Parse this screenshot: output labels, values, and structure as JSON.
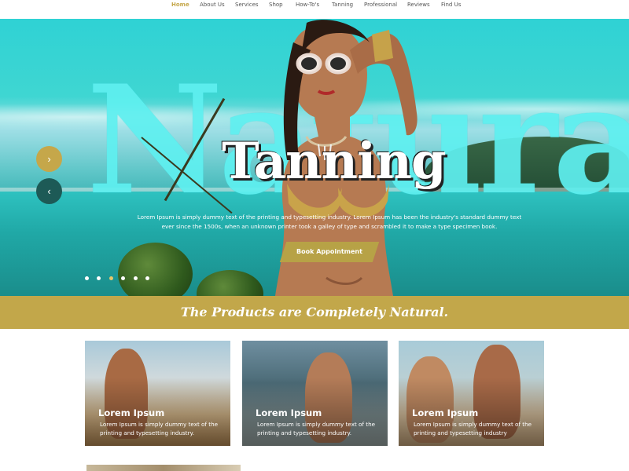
{
  "nav": {
    "items": [
      {
        "label": "Home",
        "active": true
      },
      {
        "label": "About Us",
        "active": false
      },
      {
        "label": "Services",
        "active": false
      },
      {
        "label": "Shop",
        "active": false
      },
      {
        "label": "How-To's",
        "active": false
      },
      {
        "label": "Tanning",
        "active": false
      },
      {
        "label": "Professional",
        "active": false
      },
      {
        "label": "Reviews",
        "active": false
      },
      {
        "label": "Find Us",
        "active": false
      }
    ]
  },
  "hero": {
    "background_word": "Natural",
    "headline": "Tanning",
    "body": "Lorem Ipsum is simply dummy text of the printing and typesetting industry. Lorem Ipsum has been the industry's standard dummy text ever since the 1500s, when an unknown printer took a galley of type and scrambled it to make a type specimen book.",
    "cta_label": "Book Appointment",
    "next_icon": "chevron-right-icon",
    "prev_icon": "chevron-left-icon",
    "slide_count": 6,
    "active_slide": 3
  },
  "banner": {
    "text": "The Products are Completely Natural."
  },
  "cards": [
    {
      "title": "Lorem Ipsum",
      "text": "Lorem Ipsum is simply dummy text of the printing and typesetting industry."
    },
    {
      "title": "Lorem Ipsum",
      "text": "Lorem Ipsum is simply dummy text of the printing and typesetting industry."
    },
    {
      "title": "Lorem Ipsum",
      "text": "Lorem Ipsum is simply dummy text of the printing and typesetting industry"
    }
  ],
  "colors": {
    "accent_gold": "#c2a74a",
    "cta": "#b7a246",
    "prev_button": "#1d5a56",
    "sea_turquoise": "#2fd2d4"
  }
}
